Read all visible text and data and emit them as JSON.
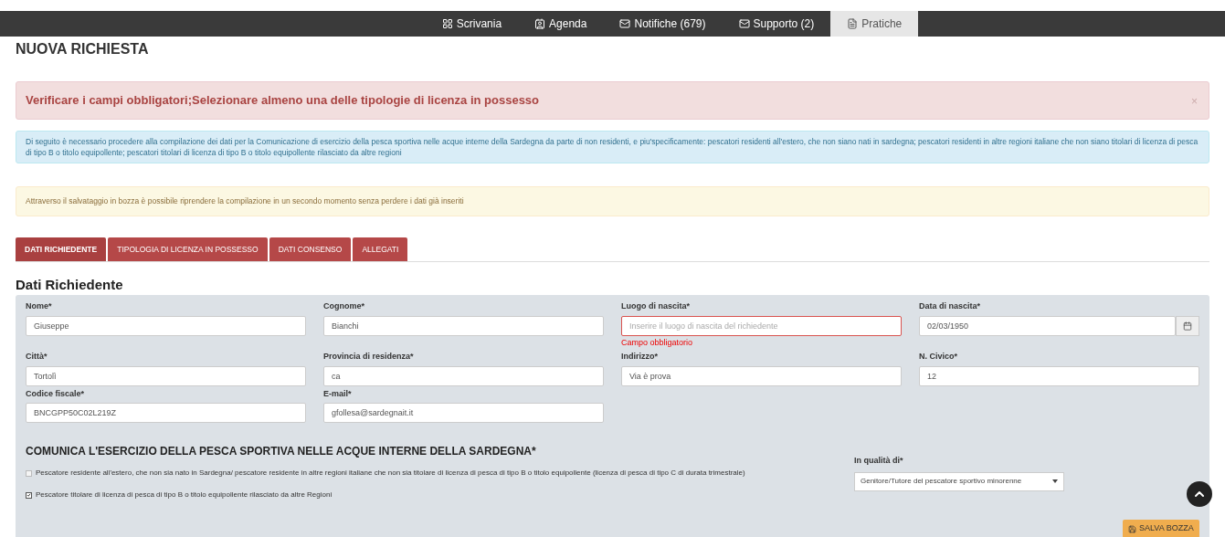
{
  "nav": {
    "items": [
      {
        "label": "Scrivania",
        "selected": false
      },
      {
        "label": "Agenda",
        "selected": false
      },
      {
        "label": "Notifiche (679)",
        "selected": false
      },
      {
        "label": "Supporto (2)",
        "selected": false
      },
      {
        "label": "Pratiche",
        "selected": true
      }
    ]
  },
  "page_title": "NUOVA RICHIESTA",
  "alerts": [
    {
      "kind": "error",
      "text": "Verificare i campi obbligatori;Selezionare almeno una delle tipologie di licenza in possesso",
      "close": "×"
    },
    {
      "kind": "info",
      "text": "Di seguito è necessario procedere alla compilazione dei dati per la Comunicazione di esercizio della pesca sportiva nelle acque interne della Sardegna da parte di non residenti, e piu'specificamente: pescatori residenti all'estero, che non siano nati in sardegna; pescatori residenti in altre regioni italiane che non siano titolari di licenza di pesca di tipo B o titolo equipollente; pescatori titolari di licenza di tipo B o titolo equipollente rilasciato da altre regioni"
    },
    {
      "kind": "warning",
      "text": "Attraverso il salvataggio in bozza è possibile riprendere la compilazione in un secondo momento senza perdere i dati già inseriti"
    }
  ],
  "tabs": [
    {
      "label": "DATI RICHIEDENTE",
      "selected": true
    },
    {
      "label": "TIPOLOGIA DI LICENZA IN POSSESSO",
      "selected": false
    },
    {
      "label": "DATI CONSENSO",
      "selected": false
    },
    {
      "label": "ALLEGATI",
      "selected": false
    }
  ],
  "section_title": "Dati Richiedente",
  "fields": [
    {
      "label": "Nome*",
      "value": "Giuseppe"
    },
    {
      "label": "Cognome*",
      "value": "Bianchi"
    },
    {
      "label": "Luogo di nascita*",
      "placeholder": "Inserire il luogo di nascita del richiedente",
      "error": "Campo obbligatorio"
    },
    {
      "label": "Data di nascita*",
      "value": "02/03/1950",
      "kind": "date"
    },
    {
      "label": "Città*",
      "value": "Tortolì"
    },
    {
      "label": "Provincia di residenza*",
      "value": "ca"
    },
    {
      "label": "Indirizzo*",
      "value": "Via è prova"
    },
    {
      "label": "N. Civico*",
      "value": "12"
    },
    {
      "label": "Codice fiscale*",
      "value": "BNCGPP50C02L219Z"
    },
    {
      "label": "E-mail*",
      "value": "gfollesa@sardegnait.it"
    }
  ],
  "comunica": {
    "title": "COMUNICA L'ESERCIZIO DELLA PESCA SPORTIVA NELLE ACQUE INTERNE DELLA SARDEGNA*",
    "options": [
      {
        "label": "Pescatore residente all'estero, che non sia nato in Sardegna/ pescatore residente in altre regioni italiane che non sia titolare di licenza di pesca di tipo B o titolo equipollente (licenza di pesca di tipo C di durata trimestrale)",
        "checked": false
      },
      {
        "label": "Pescatore titolare di licenza di pesca di tipo B o titolo equipollente rilasciato da altre Regioni",
        "checked": true
      }
    ],
    "qualita": {
      "label": "In qualità di*",
      "value": "Genitore/Tutore del pescatore sportivo minorenne"
    }
  },
  "save_button": "SALVA BOZZA"
}
